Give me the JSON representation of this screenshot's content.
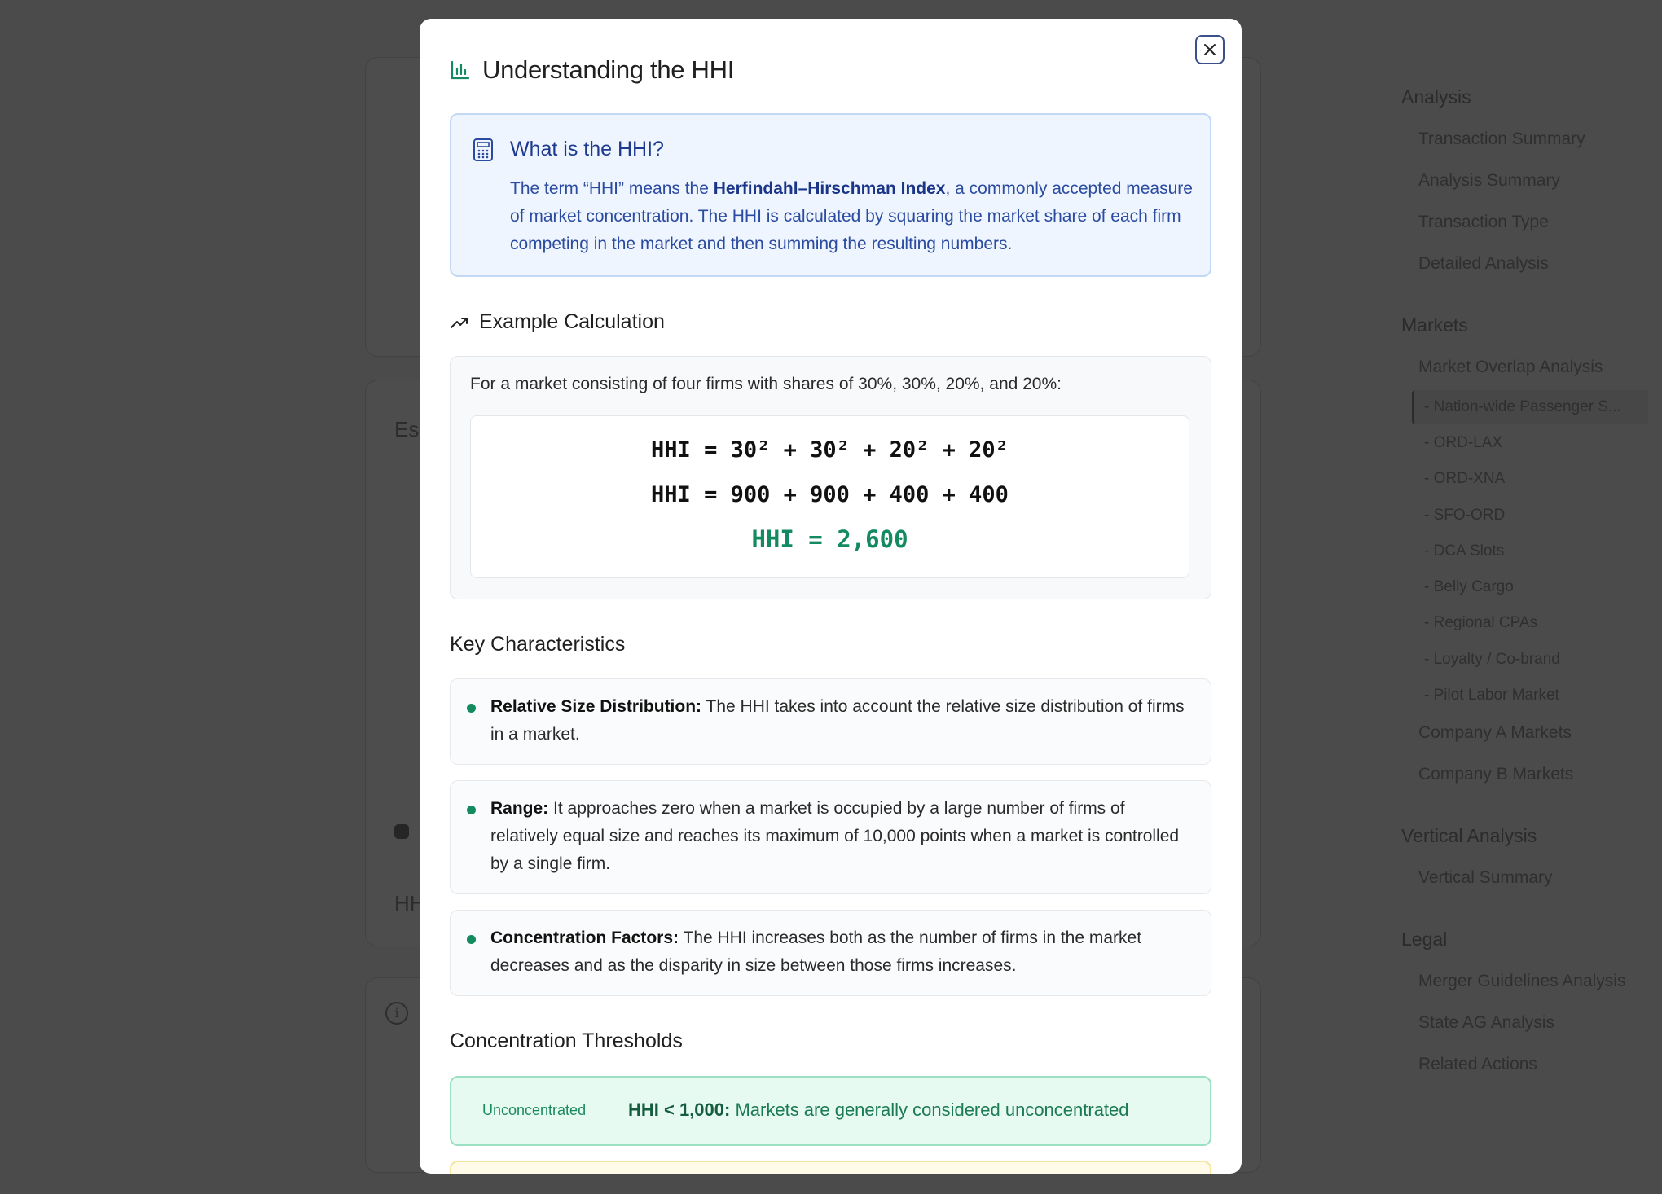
{
  "background": {
    "left_fragments": [
      "Es",
      "HH"
    ],
    "nav": {
      "sections": [
        {
          "title": "Analysis",
          "items": [
            "Transaction Summary",
            "Analysis Summary",
            "Transaction Type",
            "Detailed Analysis"
          ]
        },
        {
          "title": "Markets",
          "items": [
            "Market Overlap Analysis"
          ],
          "subitems": [
            "- Nation-wide Passenger S...",
            "- ORD-LAX",
            "- ORD-XNA",
            "- SFO-ORD",
            "- DCA Slots",
            "- Belly Cargo",
            "- Regional CPAs",
            "- Loyalty / Co-brand",
            "- Pilot Labor Market"
          ],
          "items_after": [
            "Company A Markets",
            "Company B Markets"
          ]
        },
        {
          "title": "Vertical Analysis",
          "items": [
            "Vertical Summary"
          ]
        },
        {
          "title": "Legal",
          "items": [
            "Merger Guidelines Analysis",
            "State AG Analysis",
            "Related Actions"
          ]
        }
      ]
    }
  },
  "modal": {
    "title": "Understanding the HHI",
    "title_icon": "bar-chart-icon",
    "close_icon": "close-icon",
    "what": {
      "icon": "calculator-icon",
      "title": "What is the HHI?",
      "text_before": "The term “HHI” means the ",
      "text_bold": "Herfindahl–Hirschman Index",
      "text_after": ", a commonly accepted measure of market concentration. The HHI is calculated by squaring the market share of each firm competing in the market and then summing the resulting numbers."
    },
    "example": {
      "icon": "trending-up-icon",
      "title": "Example Calculation",
      "intro": "For a market consisting of four firms with shares of 30%, 30%, 20%, and 20%:",
      "line1": "HHI = 30² + 30² + 20² + 20²",
      "line2": "HHI = 900 + 900 + 400 + 400",
      "result": "HHI = 2,600"
    },
    "characteristics": {
      "title": "Key Characteristics",
      "items": [
        {
          "label": "Relative Size Distribution:",
          "text": " The HHI takes into account the relative size distribution of firms in a market."
        },
        {
          "label": "Range:",
          "text": " It approaches zero when a market is occupied by a large number of firms of relatively equal size and reaches its maximum of 10,000 points when a market is controlled by a single firm."
        },
        {
          "label": "Concentration Factors:",
          "text": " The HHI increases both as the number of firms in the market decreases and as the disparity in size between those firms increases."
        }
      ]
    },
    "thresholds": {
      "title": "Concentration Thresholds",
      "items": [
        {
          "label": "Unconcentrated",
          "value": "HHI < 1,000:",
          "text": " Markets are generally considered unconcentrated",
          "color": "#1b8a5e"
        }
      ]
    }
  }
}
